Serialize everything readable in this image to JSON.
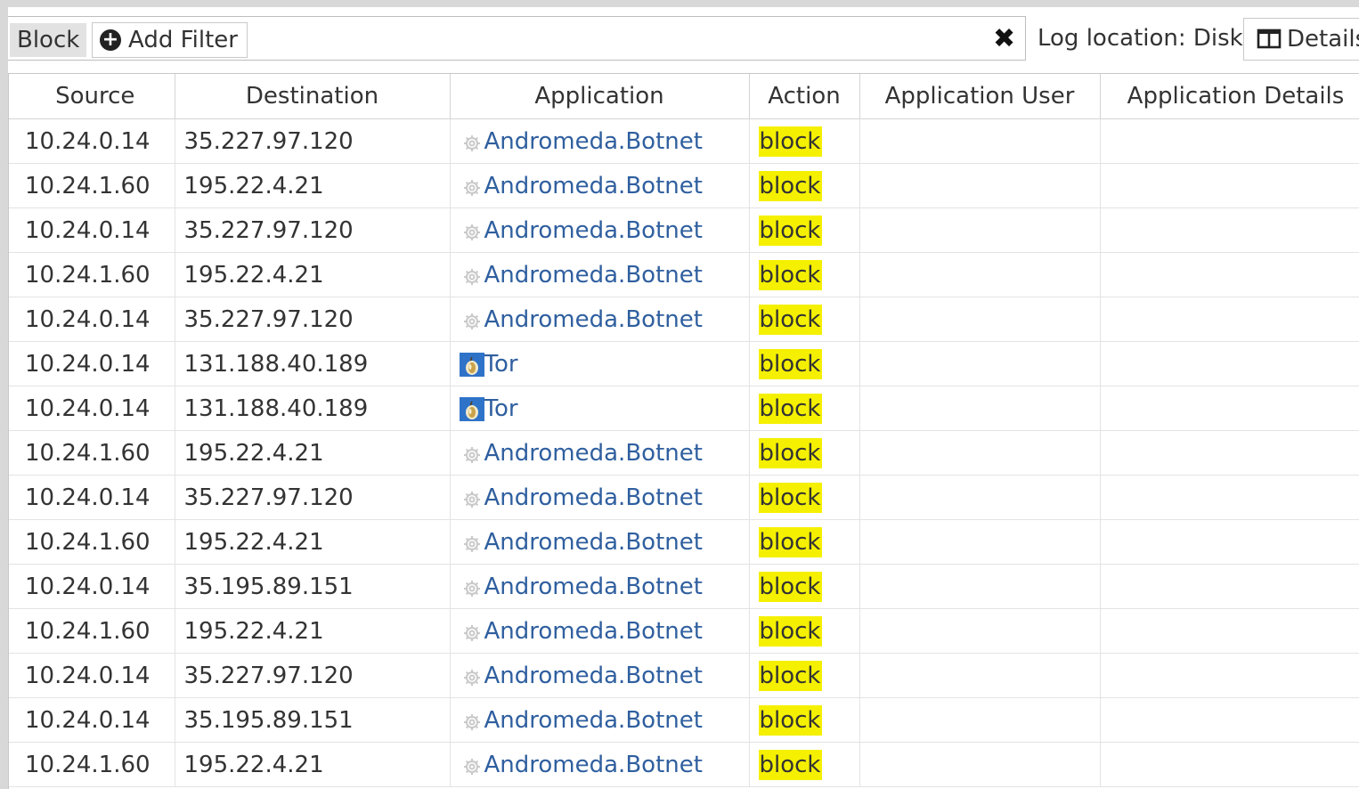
{
  "toolbar": {
    "filter_chip": "Block",
    "add_filter_label": "Add Filter",
    "log_location": "Log location: Disk",
    "details_label": "Details"
  },
  "table": {
    "columns": [
      "Source",
      "Destination",
      "Application",
      "Action",
      "Application User",
      "Application Details"
    ],
    "rows": [
      {
        "source": "10.24.0.14",
        "destination": "35.227.97.120",
        "application": "Andromeda.Botnet",
        "app_icon": "gear-icon",
        "action": "block",
        "user": "",
        "details": ""
      },
      {
        "source": "10.24.1.60",
        "destination": "195.22.4.21",
        "application": "Andromeda.Botnet",
        "app_icon": "gear-icon",
        "action": "block",
        "user": "",
        "details": ""
      },
      {
        "source": "10.24.0.14",
        "destination": "35.227.97.120",
        "application": "Andromeda.Botnet",
        "app_icon": "gear-icon",
        "action": "block",
        "user": "",
        "details": ""
      },
      {
        "source": "10.24.1.60",
        "destination": "195.22.4.21",
        "application": "Andromeda.Botnet",
        "app_icon": "gear-icon",
        "action": "block",
        "user": "",
        "details": ""
      },
      {
        "source": "10.24.0.14",
        "destination": "35.227.97.120",
        "application": "Andromeda.Botnet",
        "app_icon": "gear-icon",
        "action": "block",
        "user": "",
        "details": ""
      },
      {
        "source": "10.24.0.14",
        "destination": "131.188.40.189",
        "application": "Tor",
        "app_icon": "tor-icon",
        "action": "block",
        "user": "",
        "details": ""
      },
      {
        "source": "10.24.0.14",
        "destination": "131.188.40.189",
        "application": "Tor",
        "app_icon": "tor-icon",
        "action": "block",
        "user": "",
        "details": ""
      },
      {
        "source": "10.24.1.60",
        "destination": "195.22.4.21",
        "application": "Andromeda.Botnet",
        "app_icon": "gear-icon",
        "action": "block",
        "user": "",
        "details": ""
      },
      {
        "source": "10.24.0.14",
        "destination": "35.227.97.120",
        "application": "Andromeda.Botnet",
        "app_icon": "gear-icon",
        "action": "block",
        "user": "",
        "details": ""
      },
      {
        "source": "10.24.1.60",
        "destination": "195.22.4.21",
        "application": "Andromeda.Botnet",
        "app_icon": "gear-icon",
        "action": "block",
        "user": "",
        "details": ""
      },
      {
        "source": "10.24.0.14",
        "destination": "35.195.89.151",
        "application": "Andromeda.Botnet",
        "app_icon": "gear-icon",
        "action": "block",
        "user": "",
        "details": ""
      },
      {
        "source": "10.24.1.60",
        "destination": "195.22.4.21",
        "application": "Andromeda.Botnet",
        "app_icon": "gear-icon",
        "action": "block",
        "user": "",
        "details": ""
      },
      {
        "source": "10.24.0.14",
        "destination": "35.227.97.120",
        "application": "Andromeda.Botnet",
        "app_icon": "gear-icon",
        "action": "block",
        "user": "",
        "details": ""
      },
      {
        "source": "10.24.0.14",
        "destination": "35.195.89.151",
        "application": "Andromeda.Botnet",
        "app_icon": "gear-icon",
        "action": "block",
        "user": "",
        "details": ""
      },
      {
        "source": "10.24.1.60",
        "destination": "195.22.4.21",
        "application": "Andromeda.Botnet",
        "app_icon": "gear-icon",
        "action": "block",
        "user": "",
        "details": ""
      }
    ]
  },
  "colors": {
    "action_highlight": "#f5f000",
    "app_link": "#2f5f9f"
  }
}
